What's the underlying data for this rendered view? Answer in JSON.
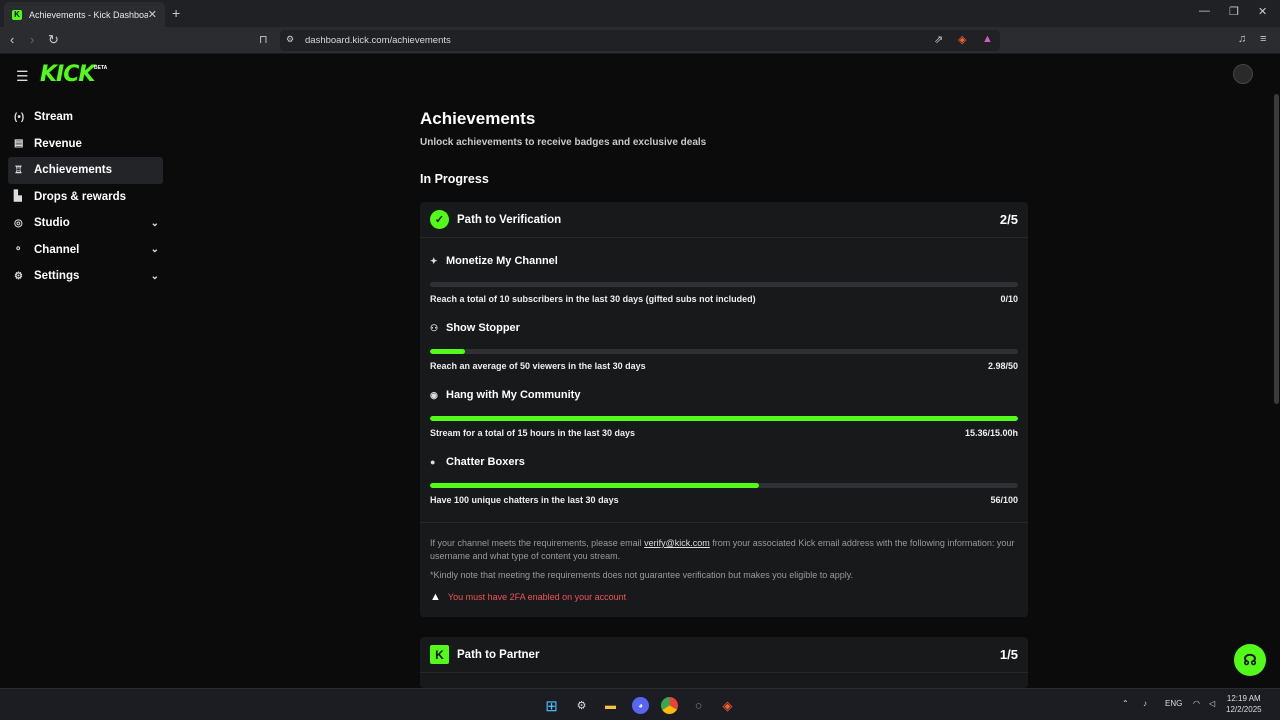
{
  "browser": {
    "tab_title": "Achievements - Kick Dashboard",
    "url": "dashboard.kick.com/achievements"
  },
  "app": {
    "logo": "KICK",
    "logo_badge": "BETA"
  },
  "sidebar": {
    "items": [
      {
        "label": "Stream",
        "icon": "broadcast-icon",
        "glyph": "(•)"
      },
      {
        "label": "Revenue",
        "icon": "revenue-icon",
        "glyph": "▤"
      },
      {
        "label": "Achievements",
        "icon": "trophy-icon",
        "glyph": "🏆"
      },
      {
        "label": "Drops & rewards",
        "icon": "drops-icon",
        "glyph": "▙"
      },
      {
        "label": "Studio",
        "icon": "studio-icon",
        "glyph": "◎"
      },
      {
        "label": "Channel",
        "icon": "channel-icon",
        "glyph": "⚬"
      },
      {
        "label": "Settings",
        "icon": "gear-icon",
        "glyph": "⚙"
      }
    ]
  },
  "page": {
    "title": "Achievements",
    "subtitle": "Unlock achievements to receive badges and exclusive deals",
    "section": "In Progress"
  },
  "verification": {
    "title": "Path to Verification",
    "count": "2/5",
    "achievements": [
      {
        "title": "Monetize My Channel",
        "desc": "Reach a total of 10 subscribers in the last 30 days (gifted subs not included)",
        "value": "0/10",
        "progress": 0.0
      },
      {
        "title": "Show Stopper",
        "desc": "Reach an average of 50 viewers in the last 30 days",
        "value": "2.98/50",
        "progress": 0.0596
      },
      {
        "title": "Hang with My Community",
        "desc": "Stream for a total of 15 hours in the last 30 days",
        "value": "15.36/15.00h",
        "progress": 1.0
      },
      {
        "title": "Chatter Boxers",
        "desc": "Have 100 unique chatters in the last 30 days",
        "value": "56/100",
        "progress": 0.56
      }
    ],
    "info_pre": "If your channel meets the requirements, please email ",
    "info_email": "verify@kick.com",
    "info_post": " from your associated Kick email address with the following information: your username and what type of content you stream.",
    "note": "*Kindly note that meeting the requirements does not guarantee verification but makes you eligible to apply.",
    "warning": "You must have 2FA enabled on your account"
  },
  "partner": {
    "title": "Path to Partner",
    "count": "1/5"
  },
  "taskbar": {
    "lang": "ENG",
    "time": "12:19 AM",
    "date": "12/2/2025"
  },
  "colors": {
    "accent": "#53fc18",
    "warning": "#f0525d"
  }
}
